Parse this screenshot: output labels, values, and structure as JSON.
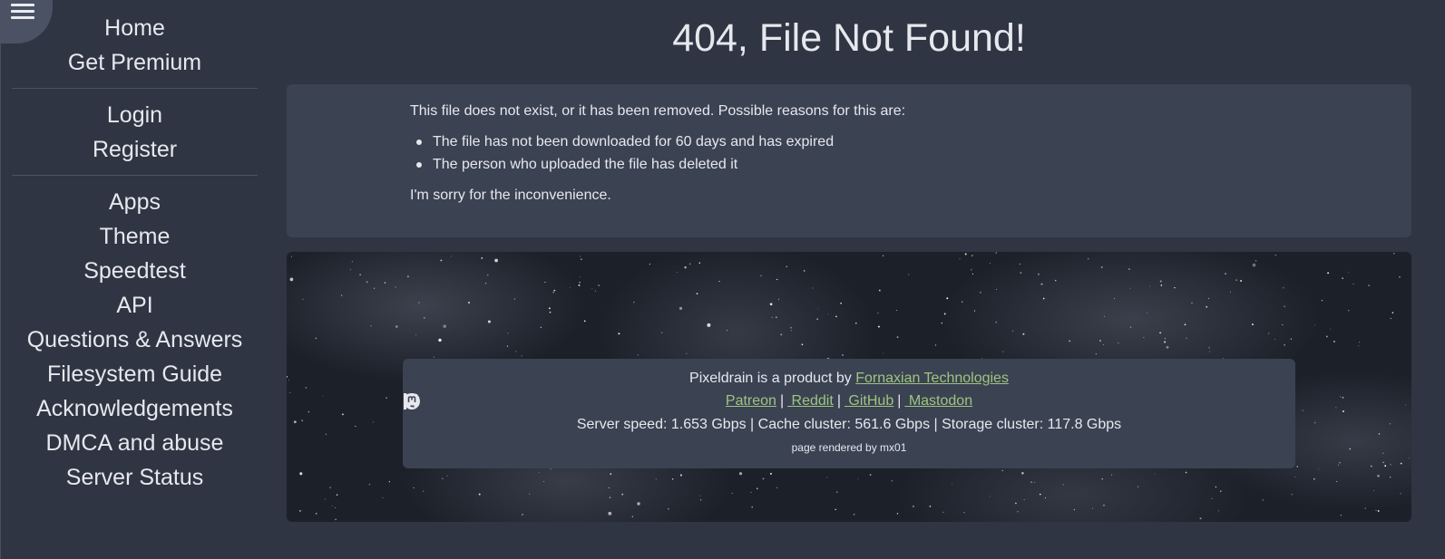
{
  "menu": {
    "icon": "hamburger-menu-icon"
  },
  "sidebar": {
    "groups": [
      [
        "Home",
        "Get Premium"
      ],
      [
        "Login",
        "Register"
      ],
      [
        "Apps",
        "Theme",
        "Speedtest",
        "API",
        "Questions & Answers",
        "Filesystem Guide",
        "Acknowledgements",
        "DMCA and abuse",
        "Server Status"
      ]
    ]
  },
  "header": {
    "title": "404, File Not Found!"
  },
  "error": {
    "intro": "This file does not exist, or it has been removed. Possible reasons for this are:",
    "reasons": [
      "The file has not been downloaded for 60 days and has expired",
      "The person who uploaded the file has deleted it"
    ],
    "apology": "I'm sorry for the inconvenience."
  },
  "footer": {
    "product_prefix": "Pixeldrain is a product by ",
    "company_link": "Fornaxian Technologies",
    "links": [
      {
        "label": " Patreon",
        "icon": "patreon-icon"
      },
      {
        "label": " Reddit",
        "icon": "reddit-icon"
      },
      {
        "label": " GitHub",
        "icon": "github-icon"
      },
      {
        "label": " Mastodon",
        "icon": "mastodon-icon"
      }
    ],
    "link_separator": "|",
    "stats": "Server speed: 1.653 Gbps | Cache cluster: 561.6 Gbps | Storage cluster: 117.8 Gbps",
    "rendered_by": "page rendered by mx01"
  },
  "colors": {
    "background": "#2f3542",
    "panel": "#3b4252",
    "link": "#9ec57f",
    "text": "#e6e8ee"
  }
}
